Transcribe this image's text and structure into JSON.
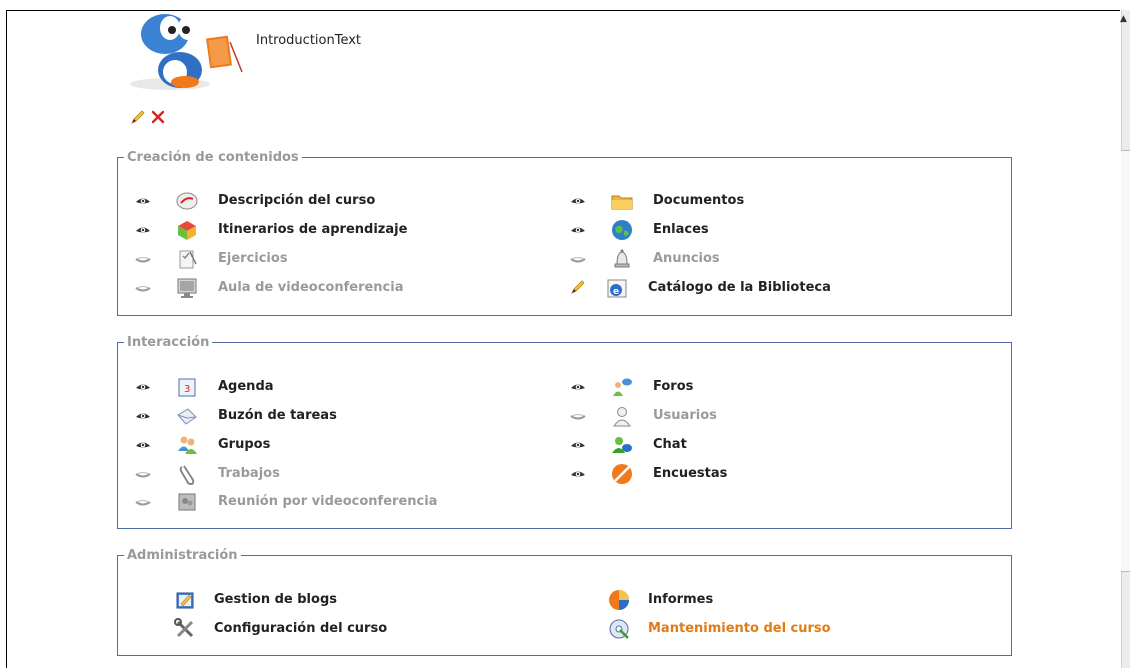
{
  "course_home": {
    "introduction_text": "IntroductionText",
    "edit_icon": "pencil-icon",
    "delete_icon": "delete-x-icon"
  },
  "sections": {
    "creacion": {
      "title": "Creación de contenidos",
      "tools": [
        {
          "label": "Descripción del curso",
          "icon": "course-description-icon",
          "visible": true
        },
        {
          "label": "Documentos",
          "icon": "folder-icon",
          "visible": true
        },
        {
          "label": "Itinerarios de aprendizaje",
          "icon": "learning-path-icon",
          "visible": true
        },
        {
          "label": "Enlaces",
          "icon": "globe-link-icon",
          "visible": true
        },
        {
          "label": "Ejercicios",
          "icon": "exercises-icon",
          "visible": false
        },
        {
          "label": "Anuncios",
          "icon": "bell-icon",
          "visible": false
        },
        {
          "label": "Aula de videoconferencia",
          "icon": "monitor-icon",
          "visible": false
        },
        {
          "label": "Catálogo de la Biblioteca",
          "icon": "browser-icon",
          "visible": true,
          "action": "pencil-icon"
        }
      ]
    },
    "interaccion": {
      "title": "Interacción",
      "tools": [
        {
          "label": "Agenda",
          "icon": "calendar-icon",
          "visible": true
        },
        {
          "label": "Foros",
          "icon": "forum-icon",
          "visible": true
        },
        {
          "label": "Buzón de tareas",
          "icon": "envelope-icon",
          "visible": true
        },
        {
          "label": "Usuarios",
          "icon": "user-icon",
          "visible": false
        },
        {
          "label": "Grupos",
          "icon": "groups-icon",
          "visible": true
        },
        {
          "label": "Chat",
          "icon": "chat-icon",
          "visible": true
        },
        {
          "label": "Trabajos",
          "icon": "paperclip-icon",
          "visible": false
        },
        {
          "label": "Encuestas",
          "icon": "survey-icon",
          "visible": true
        },
        {
          "label": "Reunión por videoconferencia",
          "icon": "video-meeting-icon",
          "visible": false
        }
      ]
    },
    "administracion": {
      "title": "Administración",
      "tools": [
        {
          "label": "Gestion de blogs",
          "icon": "blog-icon"
        },
        {
          "label": "Informes",
          "icon": "pie-chart-icon"
        },
        {
          "label": "Configuración del curso",
          "icon": "tools-icon"
        },
        {
          "label": "Mantenimiento del curso",
          "icon": "maintenance-icon"
        }
      ]
    }
  },
  "colors": {
    "section_border": "#4d6fa3",
    "legend_text": "#999999",
    "inactive_text": "#9a9a9a",
    "highlight_orange": "#e07b16"
  }
}
